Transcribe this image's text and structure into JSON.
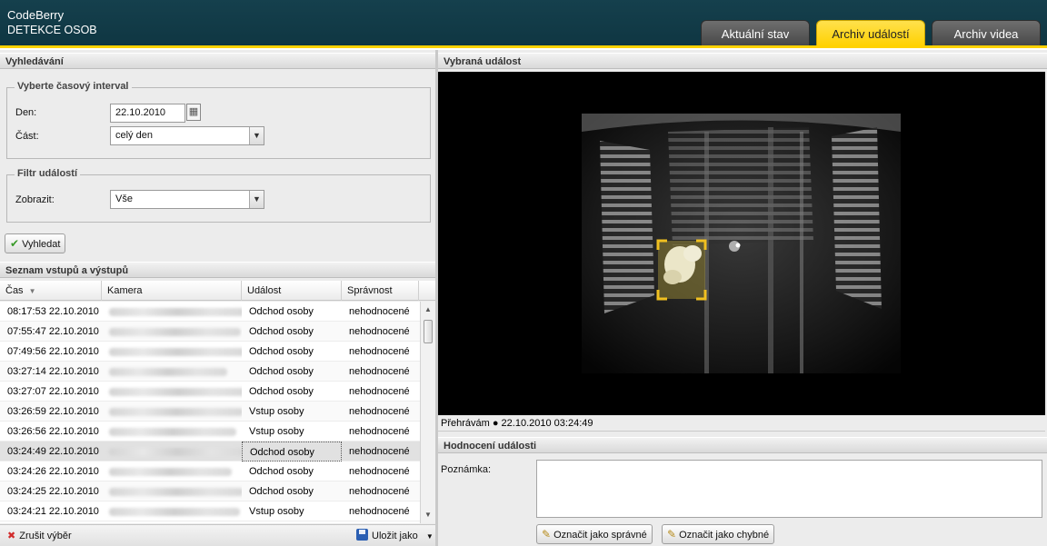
{
  "app": {
    "brand_line1": "CodeBerry",
    "brand_line2": "DETEKCE OSOB",
    "tabs": [
      {
        "label": "Aktuální stav",
        "active": false
      },
      {
        "label": "Archiv událostí",
        "active": true
      },
      {
        "label": "Archiv videa",
        "active": false
      }
    ],
    "accent_color": "#ffd200",
    "header_color": "#123c49"
  },
  "search": {
    "title": "Vyhledávání",
    "interval_legend": "Vyberte časový interval",
    "day_label": "Den:",
    "day_value": "22.10.2010",
    "part_label": "Část:",
    "part_value": "celý den",
    "filter_legend": "Filtr událostí",
    "show_label": "Zobrazit:",
    "show_value": "Vše",
    "search_button": "Vyhledat",
    "icons": {
      "search_button": "check-icon",
      "calendar": "calendar-icon"
    }
  },
  "list": {
    "title": "Seznam vstupů a výstupů",
    "columns": [
      "Čas",
      "Kamera",
      "Událost",
      "Správnost"
    ],
    "sort_column": "Čas",
    "rows": [
      {
        "time": "08:17:53 22.10.2010",
        "event": "Odchod osoby",
        "status": "nehodnocené"
      },
      {
        "time": "07:55:47 22.10.2010",
        "event": "Odchod osoby",
        "status": "nehodnocené"
      },
      {
        "time": "07:49:56 22.10.2010",
        "event": "Odchod osoby",
        "status": "nehodnocené"
      },
      {
        "time": "03:27:14 22.10.2010",
        "event": "Odchod osoby",
        "status": "nehodnocené"
      },
      {
        "time": "03:27:07 22.10.2010",
        "event": "Odchod osoby",
        "status": "nehodnocené"
      },
      {
        "time": "03:26:59 22.10.2010",
        "event": "Vstup osoby",
        "status": "nehodnocené"
      },
      {
        "time": "03:26:56 22.10.2010",
        "event": "Vstup osoby",
        "status": "nehodnocené"
      },
      {
        "time": "03:24:49 22.10.2010",
        "event": "Odchod osoby",
        "status": "nehodnocené",
        "selected": true
      },
      {
        "time": "03:24:26 22.10.2010",
        "event": "Odchod osoby",
        "status": "nehodnocené"
      },
      {
        "time": "03:24:25 22.10.2010",
        "event": "Odchod osoby",
        "status": "nehodnocené"
      },
      {
        "time": "03:24:21 22.10.2010",
        "event": "Vstup osoby",
        "status": "nehodnocené"
      }
    ],
    "clear_selection": "Zrušit výběr",
    "save_as": "Uložit jako",
    "icons": {
      "clear": "red-x-icon",
      "save": "floppy-disk-icon"
    }
  },
  "event": {
    "title": "Vybraná událost",
    "status_text": "Přehrávám ● 22.10.2010 03:24:49"
  },
  "rating": {
    "title": "Hodnocení události",
    "note_label": "Poznámka:",
    "mark_correct": "Označit jako správné",
    "mark_wrong": "Označit jako chybné",
    "icons": {
      "mark": "edit-note-icon"
    }
  }
}
